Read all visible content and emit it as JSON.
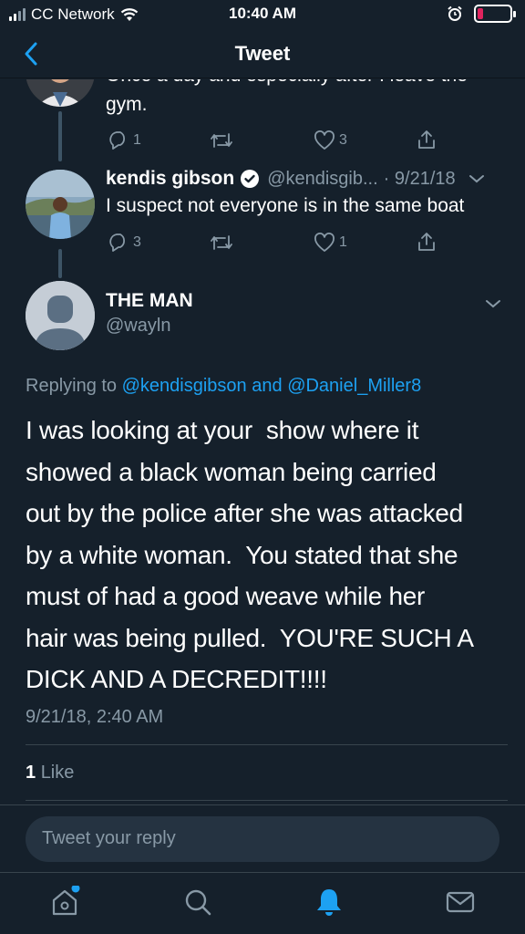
{
  "status": {
    "carrier": "CC Network",
    "time": "10:40 AM"
  },
  "nav": {
    "title": "Tweet"
  },
  "prev_tweet": {
    "text_line1": "Once a day and especially after I leave the",
    "text_line2": "gym.",
    "reply_count": "1",
    "like_count": "3"
  },
  "kendis_tweet": {
    "name": "kendis gibson",
    "handle": "@kendisgib...",
    "date": "· 9/21/18",
    "text": "I suspect not everyone is in the same boat",
    "reply_count": "3",
    "like_count": "1"
  },
  "main_tweet": {
    "name": "THE MAN",
    "handle": "@wayln",
    "replying_prefix": "Replying to",
    "replying_user1": "@kendisgibson",
    "replying_and": "and",
    "replying_user2": "@Daniel_Miller8",
    "text_lines": [
      "I was looking at your  show where it",
      "showed a black woman being carried",
      "out by the police after she was attacked",
      "by a white woman.  You stated that she",
      "must of had a good weave while her",
      "hair was being pulled.  YOU'RE SUCH A",
      "DICK AND A DECREDIT!!!!"
    ],
    "timestamp": "9/21/18, 2:40 AM",
    "like_count": "1",
    "like_label": "Like"
  },
  "reply": {
    "placeholder": "Tweet your reply"
  },
  "icons": {
    "accent": "#1da1f2",
    "muted": "#8899a6",
    "tabs": [
      "home-icon",
      "search-icon",
      "notifications-icon",
      "messages-icon"
    ]
  }
}
